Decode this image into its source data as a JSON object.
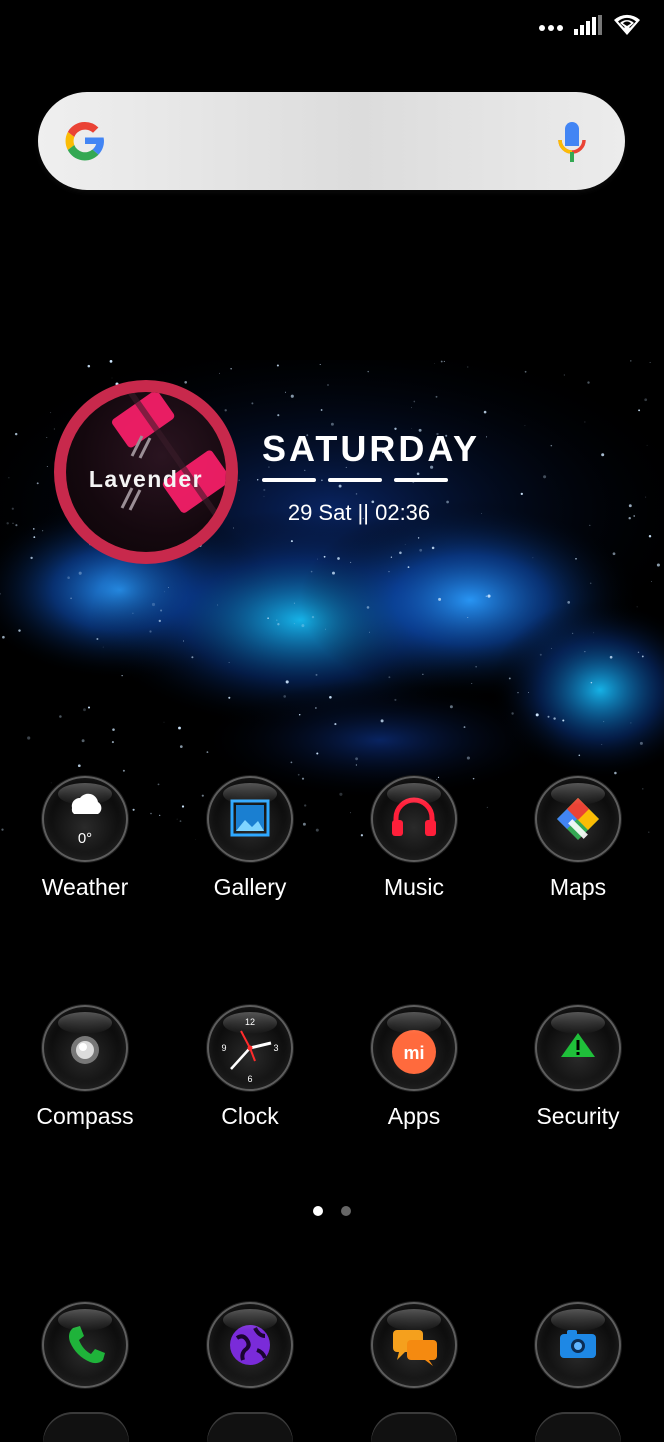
{
  "widget": {
    "logo_text": "Lavender",
    "day": "SATURDAY",
    "datetime": "29 Sat || 02:36"
  },
  "apps_row1": [
    {
      "label": "Weather",
      "icon": "weather-icon",
      "temp": "0°"
    },
    {
      "label": "Gallery",
      "icon": "gallery-icon"
    },
    {
      "label": "Music",
      "icon": "headphones-icon"
    },
    {
      "label": "Maps",
      "icon": "maps-icon"
    }
  ],
  "apps_row2": [
    {
      "label": "Compass",
      "icon": "compass-icon"
    },
    {
      "label": "Clock",
      "icon": "clock-icon",
      "dial": [
        "12",
        "3",
        "6",
        "9"
      ]
    },
    {
      "label": "Apps",
      "icon": "mi-apps-icon",
      "badge": "mi"
    },
    {
      "label": "Security",
      "icon": "security-icon"
    }
  ],
  "dock": [
    {
      "icon": "phone-icon"
    },
    {
      "icon": "browser-icon"
    },
    {
      "icon": "messages-icon"
    },
    {
      "icon": "camera-icon"
    }
  ],
  "page_indicator": {
    "count": 2,
    "active": 0
  },
  "colors": {
    "ring": "#c8294c",
    "search_bg": "#e6e6e6",
    "phone_green": "#1fb33a",
    "browser_purple": "#7a2bd9",
    "messages_orange": "#f5a01d",
    "camera_blue": "#1e88e5",
    "mi_orange": "#ff6a3d"
  }
}
